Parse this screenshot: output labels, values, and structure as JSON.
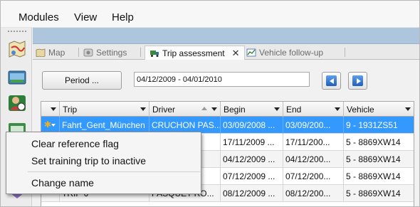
{
  "menubar": {
    "items": [
      "Modules",
      "View",
      "Help"
    ]
  },
  "tabs": [
    {
      "label": "Map",
      "icon": "map-icon",
      "active": false
    },
    {
      "label": "Settings",
      "icon": "settings-icon",
      "active": false
    },
    {
      "label": "Trip assessment",
      "icon": "truck-icon",
      "active": true,
      "closable": true
    },
    {
      "label": "Vehicle follow-up",
      "icon": "chart-icon",
      "active": false,
      "closable": true
    }
  ],
  "toolbar": {
    "period_label": "Period ...",
    "date_range": "04/12/2009 - 04/01/2010"
  },
  "grid": {
    "columns": [
      "Trip",
      "Driver",
      "Begin",
      "End",
      "Vehicle"
    ],
    "sorted_column": "Driver",
    "rows": [
      [
        "Fahrt_Gent_München",
        "CRUCHON PAS...",
        "03/09/2008 ...",
        "03/09/200...",
        "9 - 1931ZS51"
      ],
      [
        "",
        "",
        "17/11/2009 ...",
        "17/11/200...",
        "5 - 8869XW14"
      ],
      [
        "",
        "",
        "04/12/2009 ...",
        "04/12/200...",
        "5 - 8869XW14"
      ],
      [
        "",
        "",
        "07/12/2009 ...",
        "07/12/200...",
        "5 - 8869XW14"
      ],
      [
        "TRIP 6",
        "PASQUET RO...",
        "08/12/2009 ...",
        "08/12/200...",
        "5 - 8869XW14"
      ]
    ]
  },
  "context_menu": {
    "items": [
      "Clear reference flag",
      "Set training trip to inactive",
      "Change name"
    ]
  },
  "colors": {
    "selection": "#3399ff",
    "top_band": "#aec6dd",
    "nav_button": "#2f6fd0"
  }
}
